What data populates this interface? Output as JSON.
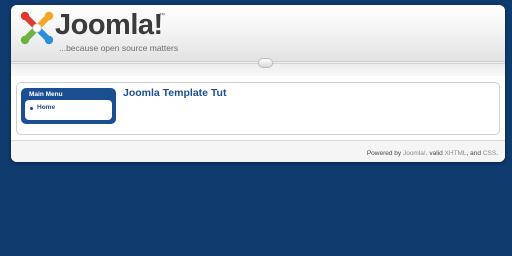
{
  "header": {
    "logo_text": "Joomla!",
    "logo_trademark": "™",
    "tagline": "...because open source matters"
  },
  "sidebar": {
    "menu_title": "Main Menu",
    "items": [
      {
        "label": "Home"
      }
    ]
  },
  "main": {
    "article_title": "Joomla Template Tut"
  },
  "footer": {
    "prefix": "Powered by ",
    "link_joomla": "Joomla!",
    "sep1": ". valid ",
    "link_xhtml": "XHTML",
    "sep2": ", and ",
    "link_css": "CSS",
    "suffix": "."
  },
  "colors": {
    "page_background": "#0e3a6e",
    "accent_blue": "#1a4f94",
    "logo_red": "#e13b2f",
    "logo_orange": "#f4a62a",
    "logo_green": "#6cb33f",
    "logo_blue": "#2c8ed6"
  }
}
